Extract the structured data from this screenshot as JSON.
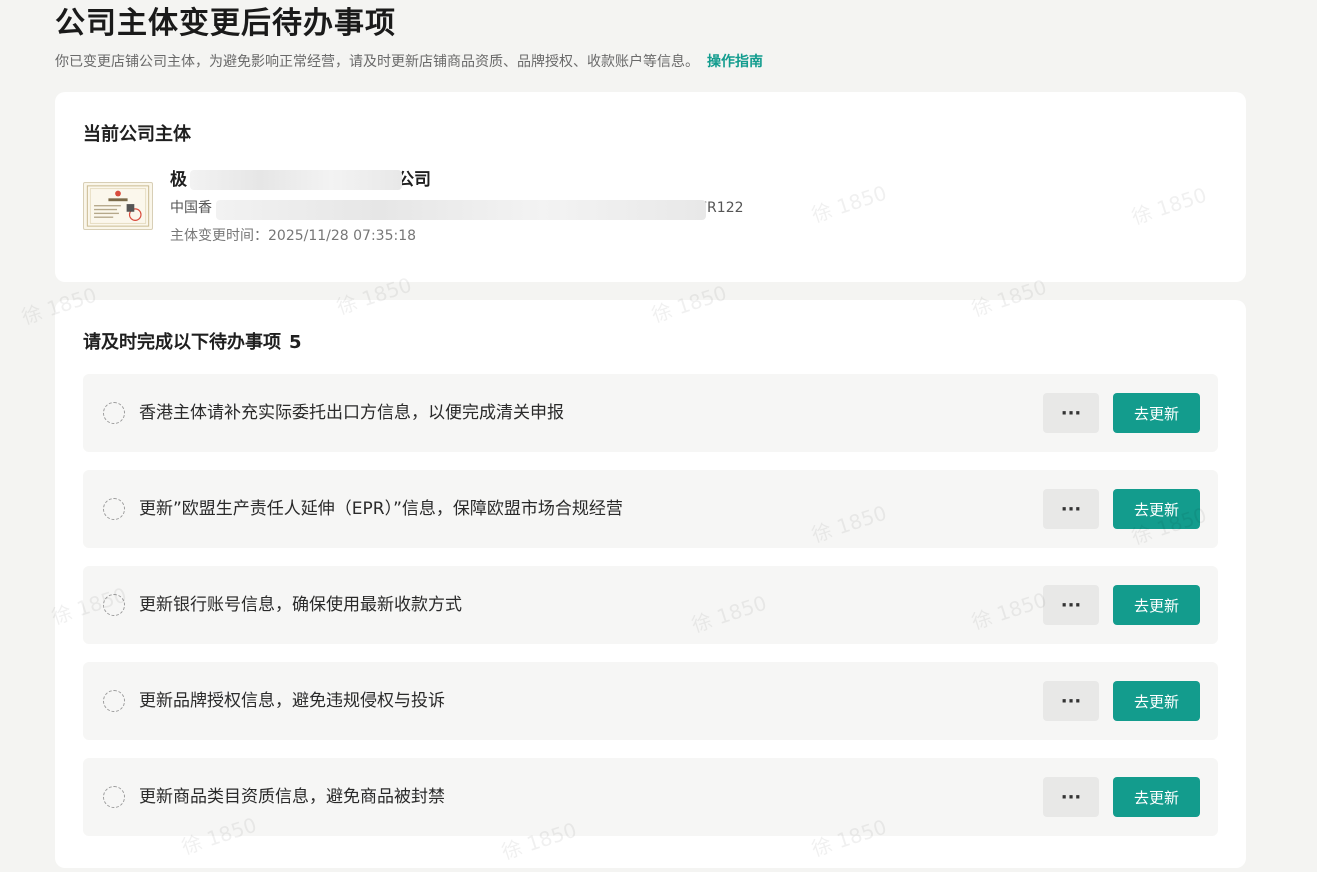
{
  "header": {
    "title": "公司主体变更后待办事项",
    "subtitle": "你已变更店铺公司主体，为避免影响正常经营，请及时更新店铺商品资质、品牌授权、收款账户等信息。",
    "guide_link": "操作指南"
  },
  "company": {
    "section_title": "当前公司主体",
    "name_prefix": "极",
    "name_suffix": "公司",
    "address_prefix": "中国香",
    "address_suffix": "FR122",
    "change_time": "主体变更时间：2025/11/28 07:35:18"
  },
  "todo": {
    "section_title": "请及时完成以下待办事项",
    "count": "5",
    "items": [
      {
        "text": "香港主体请补充实际委托出口方信息，以便完成清关申报",
        "more_label": "···",
        "action_label": "去更新"
      },
      {
        "text": "更新”欧盟生产责任人延伸（EPR）”信息，保障欧盟市场合规经营",
        "more_label": "···",
        "action_label": "去更新"
      },
      {
        "text": "更新银行账号信息，确保使用最新收款方式",
        "more_label": "···",
        "action_label": "去更新"
      },
      {
        "text": "更新品牌授权信息，避免违规侵权与投诉",
        "more_label": "···",
        "action_label": "去更新"
      },
      {
        "text": "更新商品类目资质信息，避免商品被封禁",
        "more_label": "···",
        "action_label": "去更新"
      }
    ]
  },
  "watermark": {
    "text": "徐 1850"
  },
  "colors": {
    "accent": "#139c8d",
    "link": "#129c8e",
    "background": "#f4f4f2",
    "card": "#ffffff"
  }
}
